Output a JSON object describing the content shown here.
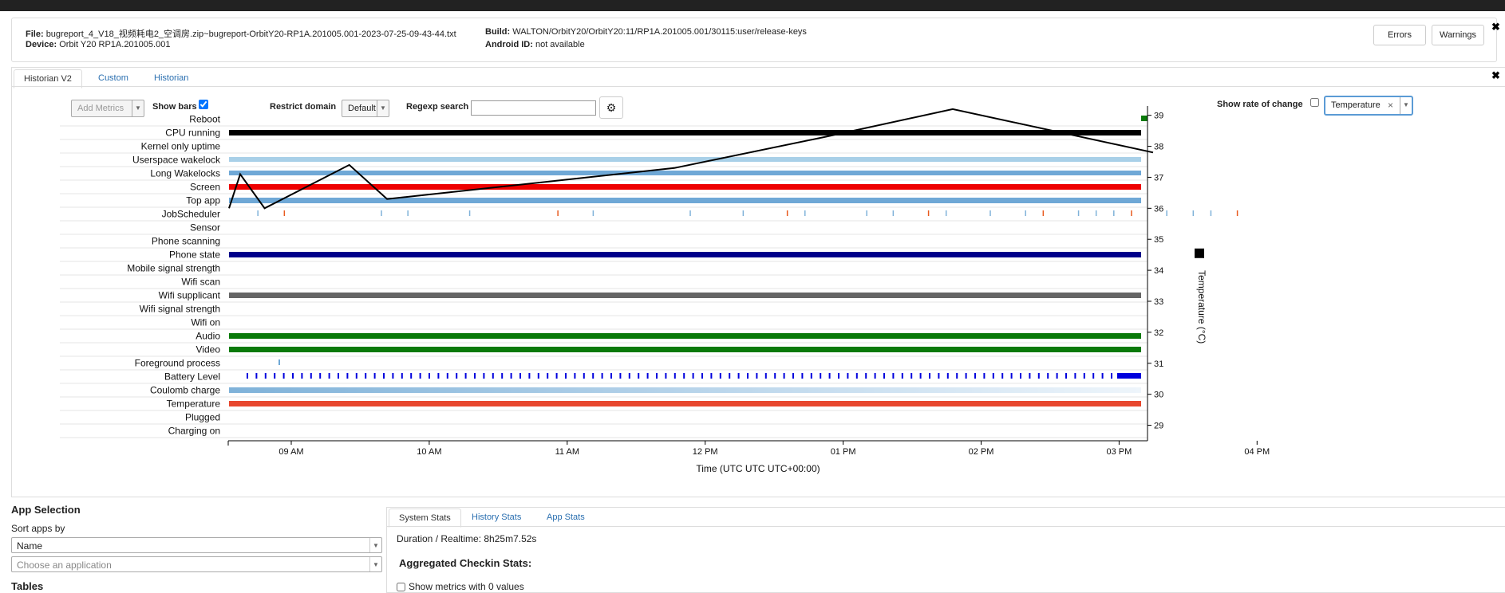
{
  "file_panel": {
    "file_label": "File:",
    "file_value": "bugreport_4_V18_视频耗电2_空调房.zip~bugreport-OrbitY20-RP1A.201005.001-2023-07-25-09-43-44.txt",
    "device_label": "Device:",
    "device_value": "Orbit Y20 RP1A.201005.001",
    "build_label": "Build:",
    "build_value": "WALTON/OrbitY20/OrbitY20:11/RP1A.201005.001/30115:user/release-keys",
    "android_id_label": "Android ID:",
    "android_id_value": "not available",
    "errors_label": "Errors",
    "warnings_label": "Warnings",
    "close_glyph": "✖"
  },
  "historian": {
    "tabs": [
      "Historian V2",
      "Custom",
      "Historian"
    ],
    "active_tab": "Historian V2",
    "close_glyph": "✖",
    "add_metrics_label": "Add Metrics",
    "show_bars_label": "Show bars",
    "show_bars_checked": true,
    "restrict_domain_label": "Restrict domain",
    "restrict_domain_value": "Default",
    "regexp_label": "Regexp search",
    "regexp_value": "",
    "settings_icon": "gear-icon",
    "show_rate_label": "Show rate of change",
    "show_rate_checked": false,
    "metric_selected": "Temperature",
    "metric_remove_glyph": "×"
  },
  "chart_data": {
    "type": "timeline",
    "xlabel": "Time (UTC UTC UTC+00:00)",
    "x_ticks": [
      "09 AM",
      "10 AM",
      "11 AM",
      "12 PM",
      "01 PM",
      "02 PM",
      "03 PM",
      "04 PM"
    ],
    "y2label": "Temperature (°C)",
    "y2_range": [
      28.5,
      39.3
    ],
    "y2_ticks": [
      39,
      38,
      37,
      36,
      35,
      34,
      33,
      32,
      31,
      30,
      29
    ],
    "rows": [
      "Reboot",
      "CPU running",
      "Kernel only uptime",
      "Userspace wakelock",
      "Long Wakelocks",
      "Screen",
      "Top app",
      "JobScheduler",
      "Sensor",
      "Phone scanning",
      "Phone state",
      "Mobile signal strength",
      "Wifi scan",
      "Wifi supplicant",
      "Wifi signal strength",
      "Wifi on",
      "Audio",
      "Video",
      "Foreground process",
      "Battery Level",
      "Coulomb charge",
      "Temperature",
      "Plugged",
      "Charging on"
    ],
    "bar_colors": {
      "CPU running": "#000000",
      "Userspace wakelock": "#a9d0e8",
      "Long Wakelocks": "#6fa8d6",
      "Screen": "#ee0000",
      "Top app": "#6fa8d6",
      "Phone state": "#00008b",
      "Wifi supplicant": "#666666",
      "Audio": "#0a7a0a",
      "Video": "#0a7a0a",
      "Temperature": "#e8472e",
      "Coulomb charge": "#7fb2d9",
      "Reboot": "#0a7a0a",
      "Battery Level": "#0000dd"
    },
    "temperature_series": {
      "name": "Temperature",
      "points_hours_after_0800": [
        [
          0.0,
          36.0
        ],
        [
          0.1,
          37.1
        ],
        [
          0.32,
          36.0
        ],
        [
          1.08,
          37.4
        ],
        [
          1.42,
          36.3
        ],
        [
          4.0,
          37.3
        ],
        [
          5.35,
          38.3
        ],
        [
          6.5,
          39.2
        ],
        [
          8.3,
          37.8
        ]
      ]
    },
    "legend_marker": "black-square"
  },
  "app_selection": {
    "title": "App Selection",
    "sort_label": "Sort apps by",
    "sort_value": "Name",
    "choose_placeholder": "Choose an application",
    "tables_label": "Tables"
  },
  "stats": {
    "tabs": [
      "System Stats",
      "History Stats",
      "App Stats"
    ],
    "active_tab": "System Stats",
    "duration_text": "Duration / Realtime: 8h25m7.52s",
    "aggregated_title": "Aggregated Checkin Stats:",
    "show_zero_label": "Show metrics with 0 values"
  }
}
